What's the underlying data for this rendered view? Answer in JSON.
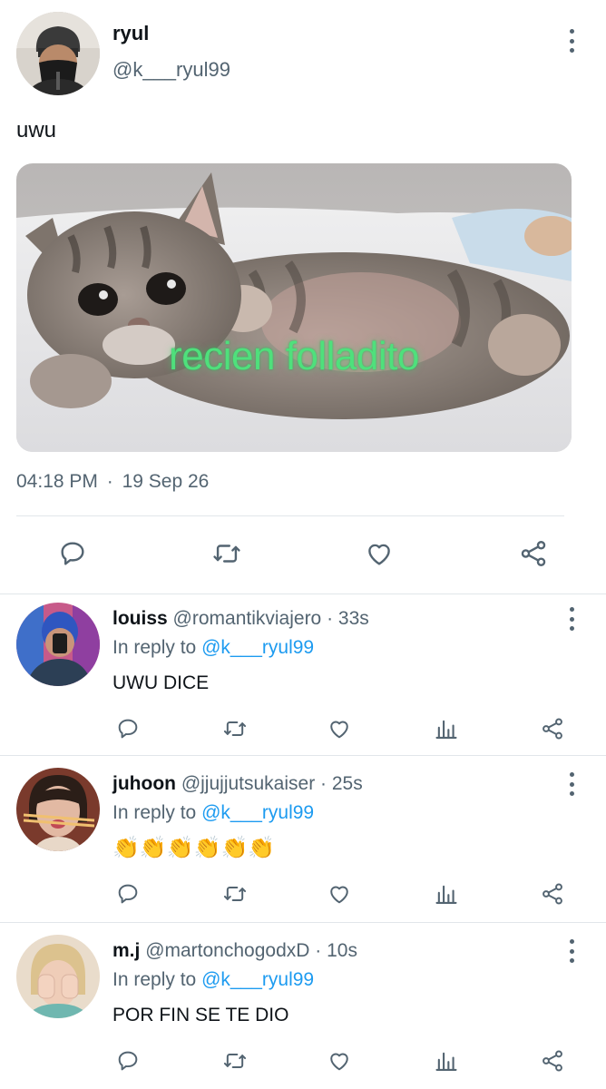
{
  "tweet": {
    "name": "ryul",
    "handle": "@k___ryul99",
    "text": "uwu",
    "media_caption": "recien folladito",
    "time": "04:18 PM",
    "date": "19 Sep 26",
    "time_separator": "·"
  },
  "replies": [
    {
      "name": "louiss",
      "handle": "@romantikviajero",
      "age": "33s",
      "in_reply_label": "In reply to",
      "in_reply_to": "@k___ryul99",
      "text": "UWU DICE"
    },
    {
      "name": "juhoon",
      "handle": "@jjujjutsukaiser",
      "age": "25s",
      "in_reply_label": "In reply to",
      "in_reply_to": "@k___ryul99",
      "text": "👏👏👏👏👏👏"
    },
    {
      "name": "m.j",
      "handle": "@martonchogodxD",
      "age": "10s",
      "in_reply_label": "In reply to",
      "in_reply_to": "@k___ryul99",
      "text": "POR FIN SE TE DIO"
    }
  ],
  "colors": {
    "text": "#0f1419",
    "secondary": "#536471",
    "link": "#1d9bf0",
    "divider": "#e1e6ea",
    "caption": "#4fe07c"
  },
  "icons": [
    "more-vertical-icon",
    "reply-icon",
    "retweet-icon",
    "like-icon",
    "share-icon",
    "analytics-icon"
  ]
}
